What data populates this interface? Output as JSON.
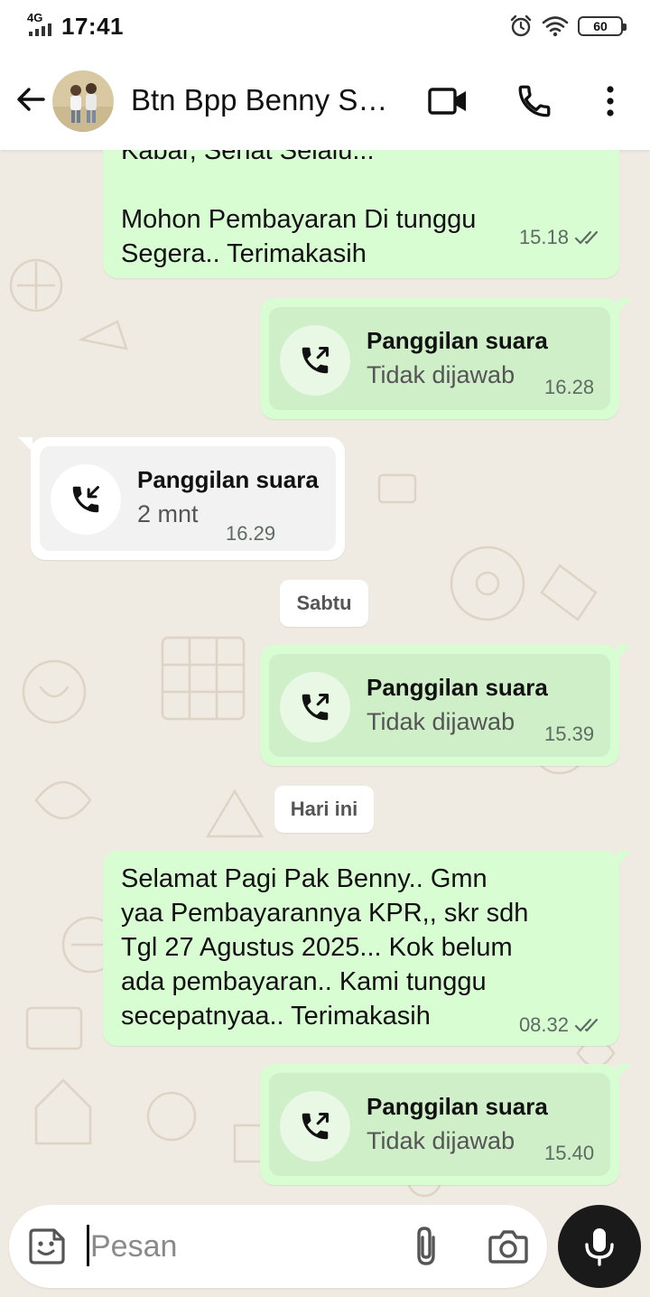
{
  "status_bar": {
    "network": "4G",
    "time": "17:41",
    "battery": "60",
    "icons": [
      "signal-icon",
      "alarm-icon",
      "wifi-icon",
      "battery-icon"
    ]
  },
  "header": {
    "contact_name": "Btn Bpp Benny So...",
    "icons": [
      "back-arrow-icon",
      "avatar",
      "video-call-icon",
      "phone-icon",
      "more-vert-icon"
    ]
  },
  "messages": [
    {
      "type": "text",
      "direction": "out",
      "text_lines": [
        "Kabar, Sehat Selalu...",
        "",
        "Mohon Pembayaran Di tunggu",
        "Segera.. Terimakasih"
      ],
      "time": "15.18",
      "ticks": "double-check-icon"
    },
    {
      "type": "call",
      "direction": "out",
      "title": "Panggilan suara",
      "subtitle": "Tidak dijawab",
      "time": "16.28",
      "icon": "outgoing-call-icon"
    },
    {
      "type": "call",
      "direction": "in",
      "title": "Panggilan suara",
      "subtitle": "2 mnt",
      "time": "16.29",
      "icon": "incoming-call-icon"
    },
    {
      "type": "date",
      "label": "Sabtu"
    },
    {
      "type": "call",
      "direction": "out",
      "title": "Panggilan suara",
      "subtitle": "Tidak dijawab",
      "time": "15.39",
      "icon": "outgoing-call-icon"
    },
    {
      "type": "date",
      "label": "Hari ini"
    },
    {
      "type": "text",
      "direction": "out",
      "text_lines": [
        "Selamat Pagi Pak Benny.. Gmn",
        "yaa Pembayarannya KPR,, skr sdh",
        "Tgl 27 Agustus 2025... Kok belum",
        "ada pembayaran.. Kami tunggu",
        "secepatnyaa.. Terimakasih"
      ],
      "time": "08.32",
      "ticks": "double-check-icon"
    },
    {
      "type": "call",
      "direction": "out",
      "title": "Panggilan suara",
      "subtitle": "Tidak dijawab",
      "time": "15.40",
      "icon": "outgoing-call-icon"
    }
  ],
  "composer": {
    "placeholder": "Pesan",
    "icons": [
      "sticker-icon",
      "attach-icon",
      "camera-icon",
      "mic-icon"
    ]
  },
  "colors": {
    "outgoing_bubble": "#d9fdd3",
    "incoming_bubble": "#ffffff",
    "chat_background": "#efeae2",
    "tick_color": "#5e6b62"
  }
}
